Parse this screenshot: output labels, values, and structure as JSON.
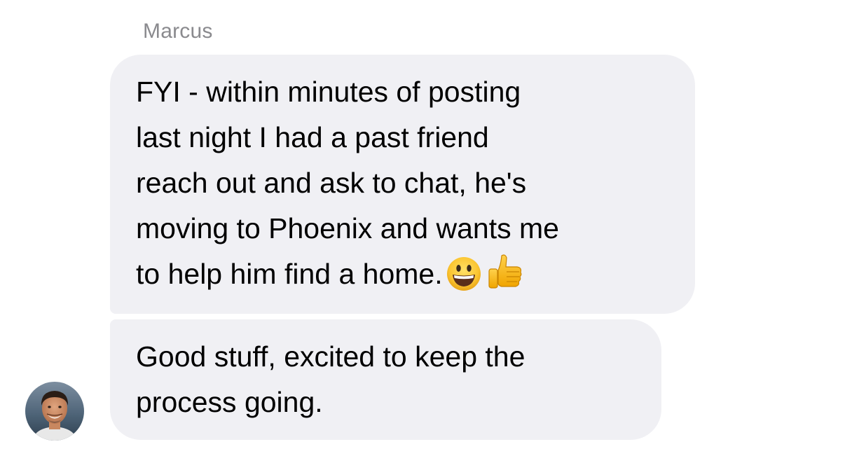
{
  "conversation": {
    "sender_name": "Marcus",
    "messages": [
      {
        "lines": [
          "FYI - within minutes of posting",
          "last night I had a past friend",
          "reach out and ask to chat, he's",
          "moving to Phoenix and wants me",
          "to help him find a home."
        ],
        "emojis": [
          "grinning-face-emoji",
          "thumbs-up-emoji"
        ]
      },
      {
        "lines": [
          "Good stuff, excited to keep the",
          "process going."
        ]
      }
    ],
    "avatar": "avatar-photo",
    "colors": {
      "bubble_background": "#f0f0f4",
      "sender_name": "#8a8a8e",
      "message_text": "#000000"
    }
  }
}
